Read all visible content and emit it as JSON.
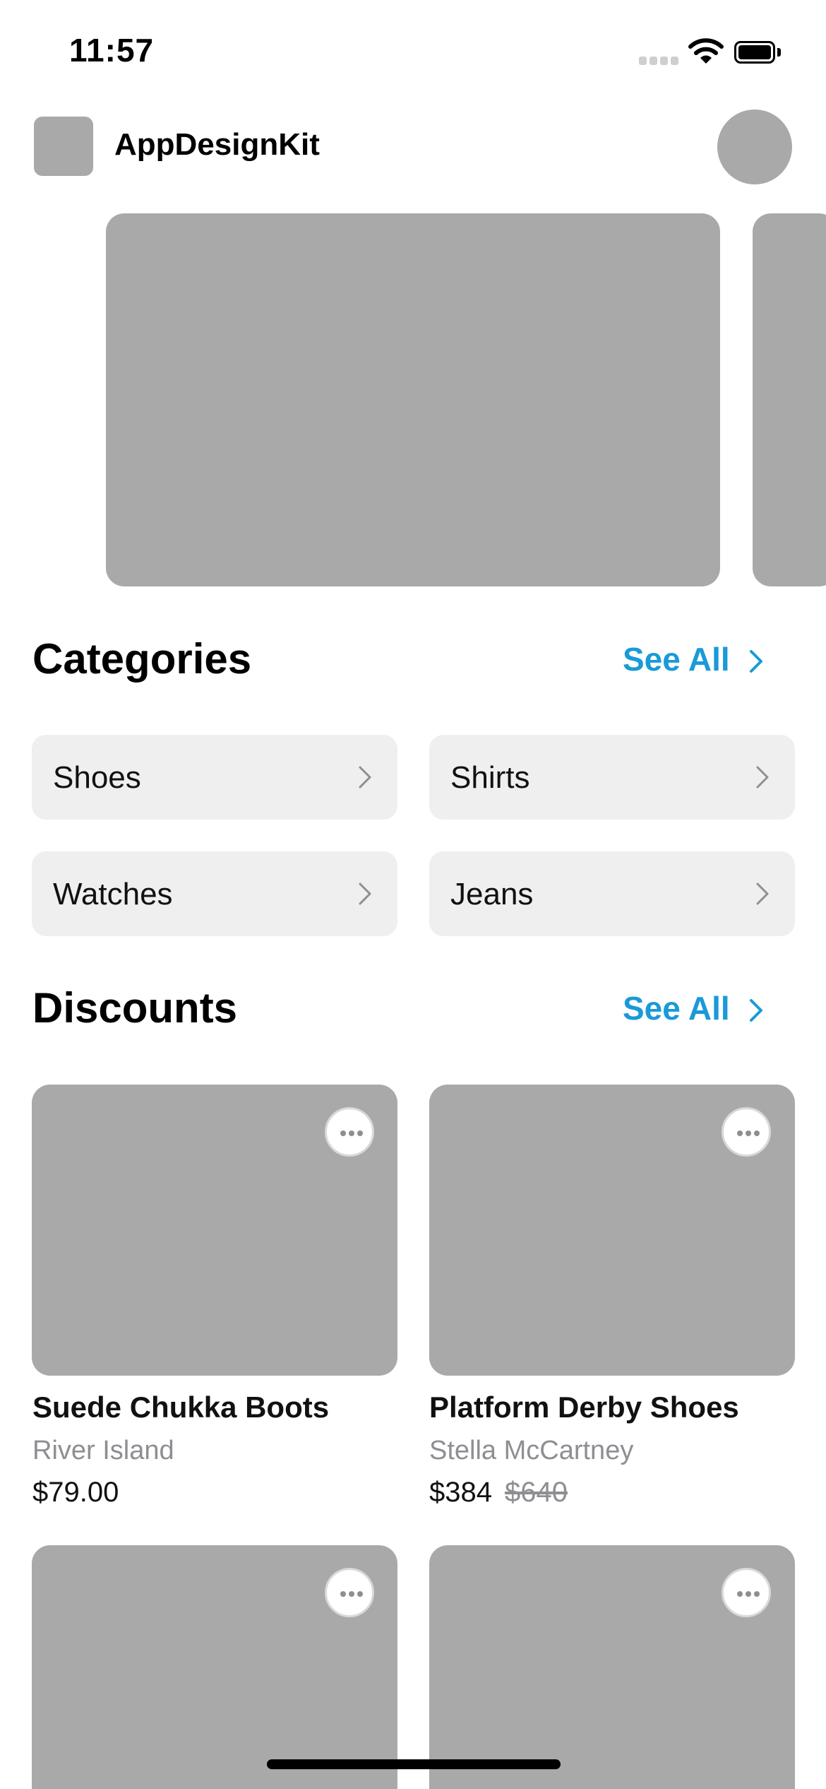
{
  "status_bar": {
    "time": "11:57"
  },
  "header": {
    "app_name": "AppDesignKit"
  },
  "categories": {
    "title": "Categories",
    "see_all": "See All",
    "items": [
      {
        "label": "Shoes"
      },
      {
        "label": "Shirts"
      },
      {
        "label": "Watches"
      },
      {
        "label": "Jeans"
      }
    ]
  },
  "discounts": {
    "title": "Discounts",
    "see_all": "See All",
    "products": [
      {
        "name": "Suede Chukka Boots",
        "brand": "River Island",
        "price": "$79.00",
        "old_price": ""
      },
      {
        "name": "Platform Derby Shoes",
        "brand": "Stella McCartney",
        "price": "$384",
        "old_price": "$640"
      }
    ]
  },
  "colors": {
    "accent": "#1a9ad8",
    "placeholder": "#a9a9a9",
    "category_bg": "#efefef",
    "secondary_text": "#8e8e93"
  },
  "icons": {
    "see_all": "chevron-right-icon",
    "category": "chevron-right-icon",
    "product_menu": "ellipsis-icon"
  }
}
